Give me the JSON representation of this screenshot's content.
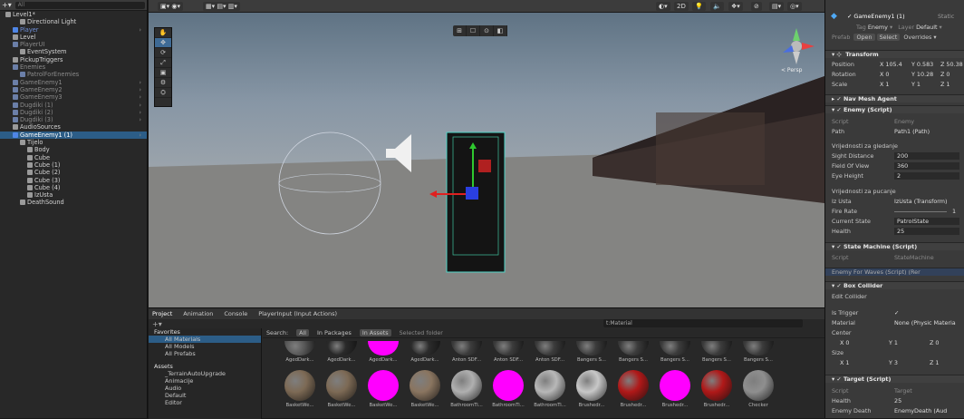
{
  "hierarchy": {
    "search": "All",
    "items": [
      {
        "label": "Level1*",
        "color": "w",
        "indent": 0,
        "bold": true
      },
      {
        "label": "Directional Light",
        "color": "w",
        "indent": 2
      },
      {
        "label": "Player",
        "color": "b",
        "indent": 1,
        "arrow": true
      },
      {
        "label": "Level",
        "color": "w",
        "indent": 1
      },
      {
        "label": "PlayerUI",
        "color": "g",
        "indent": 1
      },
      {
        "label": "EventSystem",
        "color": "w",
        "indent": 2
      },
      {
        "label": "PickupTriggers",
        "color": "w",
        "indent": 1
      },
      {
        "label": "Enemies",
        "color": "g",
        "indent": 1
      },
      {
        "label": "PatrolForEnemies",
        "color": "g",
        "indent": 2
      },
      {
        "label": "GameEnemy1",
        "color": "g",
        "indent": 1,
        "arrow": true
      },
      {
        "label": "GameEnemy2",
        "color": "g",
        "indent": 1,
        "arrow": true
      },
      {
        "label": "GameEnemy3",
        "color": "g",
        "indent": 1,
        "arrow": true
      },
      {
        "label": "Dugdiki (1)",
        "color": "g",
        "indent": 1,
        "arrow": true
      },
      {
        "label": "Dugdiki (2)",
        "color": "g",
        "indent": 1,
        "arrow": true
      },
      {
        "label": "Dugdiki (3)",
        "color": "g",
        "indent": 1,
        "arrow": true
      },
      {
        "label": "AudioSources",
        "color": "w",
        "indent": 1
      },
      {
        "label": "GameEnemy1 (1)",
        "color": "b",
        "indent": 1,
        "selected": true,
        "arrow": true
      },
      {
        "label": "Tijelo",
        "color": "w",
        "indent": 2
      },
      {
        "label": "Body",
        "color": "w",
        "indent": 3
      },
      {
        "label": "Cube",
        "color": "w",
        "indent": 3
      },
      {
        "label": "Cube (1)",
        "color": "w",
        "indent": 3
      },
      {
        "label": "Cube (2)",
        "color": "w",
        "indent": 3
      },
      {
        "label": "Cube (3)",
        "color": "w",
        "indent": 3
      },
      {
        "label": "Cube (4)",
        "color": "w",
        "indent": 3
      },
      {
        "label": "IzUsta",
        "color": "w",
        "indent": 3
      },
      {
        "label": "DeathSound",
        "color": "w",
        "indent": 2
      }
    ]
  },
  "scene": {
    "toolbar": [
      "2D"
    ],
    "persp_label": "< Persp",
    "tools": [
      "✋",
      "✥",
      "⟳",
      "⤢",
      "▣",
      "⚙",
      "⛭"
    ],
    "scene_buttons": [
      "⊞",
      "☐",
      "⊙",
      "◧"
    ]
  },
  "project": {
    "tabs": [
      "Project",
      "Animation",
      "Console",
      "PlayerInput (Input Actions)"
    ],
    "search_value": "t:Material",
    "favorites_label": "Favorites",
    "favorites": [
      "All Materials",
      "All Models",
      "All Prefabs"
    ],
    "assets_label": "Assets",
    "assets": [
      "_TerrainAutoUpgrade",
      "Animacije",
      "Audio",
      "Default",
      "Editor"
    ],
    "filter": {
      "search_label": "Search:",
      "all": "All",
      "in_packages": "In Packages",
      "in_assets": "In Assets",
      "selected_folder": "Selected folder"
    },
    "row1": [
      "AgedDark...",
      "AgedDark...",
      "AgedDark...",
      "AgedDark...",
      "Anton SDF...",
      "Anton SDF...",
      "Anton SDF...",
      "Bangers S...",
      "Bangers S...",
      "Bangers S...",
      "Bangers S...",
      "Bangers S..."
    ],
    "row2": [
      "BasketWe...",
      "BasketWe...",
      "BasketWe...",
      "BasketWe...",
      "BathroomTi...",
      "BathroomTi...",
      "BathroomTi...",
      "Brushedr...",
      "Brushedr...",
      "Brushedr...",
      "Brushedr...",
      "Checker"
    ],
    "row2_colors": [
      "#7d6a55",
      "#7d6a55",
      "#ff00ff",
      "#8a7560",
      "#b0b0b0",
      "#ff00ff",
      "#b8b8b8",
      "#c8c8c8",
      "#b01818",
      "#ff00ff",
      "#b01818",
      "#8f8f8f"
    ]
  },
  "inspector": {
    "object": "GameEnemy1 (1)",
    "static": "Static",
    "tag_label": "Tag",
    "tag": "Enemy",
    "layer_label": "Layer",
    "layer": "Default",
    "prefab": "Prefab",
    "open": "Open",
    "select": "Select",
    "overrides": "Overrides",
    "transform": "Transform",
    "position_label": "Position",
    "pos_x": "X 105.4",
    "pos_y": "Y 0.583",
    "pos_z": "Z 50.38",
    "rotation_label": "Rotation",
    "rot_x": "X 0",
    "rot_y": "Y 10.28",
    "rot_z": "Z 0",
    "scale_label": "Scale",
    "sc_x": "X 1",
    "sc_y": "Y 1",
    "sc_z": "Z 1",
    "navmesh": "Nav Mesh Agent",
    "enemy": "Enemy (Script)",
    "script_label": "Script",
    "enemy_script": "Enemy",
    "path_label": "Path",
    "path": "Path1 (Path)",
    "sight_header": "Vrijednosti za gledanje",
    "sight_label": "Sight Distance",
    "sight": "200",
    "fov_label": "Field Of View",
    "fov": "360",
    "eye_label": "Eye Height",
    "eye": "2",
    "shoot_header": "Vrijednosti za pucanje",
    "izusta_label": "Iz Usta",
    "izusta": "IzUsta (Transform)",
    "fire_label": "Fire Rate",
    "fire": "1",
    "state_label": "Current State",
    "state": "PatrolState",
    "health_label": "Health",
    "health": "25",
    "sm": "State Machine (Script)",
    "sm_script": "StateMachine",
    "efw": "Enemy For Waves (Script) (Rer",
    "box": "Box Collider",
    "edit_label": "Edit Collider",
    "trigger_label": "Is Trigger",
    "mat_label": "Material",
    "mat": "None (Physic Materia",
    "center_label": "Center",
    "c_x": "X 0",
    "c_y": "Y 1",
    "c_z": "Z 0",
    "size_label": "Size",
    "s_x": "X 1",
    "s_y": "Y 3",
    "s_z": "Z 1",
    "target": "Target (Script)",
    "target_script": "Target",
    "t_health": "25",
    "death_label": "Enemy Death",
    "death": "EnemyDeath (Aud"
  }
}
